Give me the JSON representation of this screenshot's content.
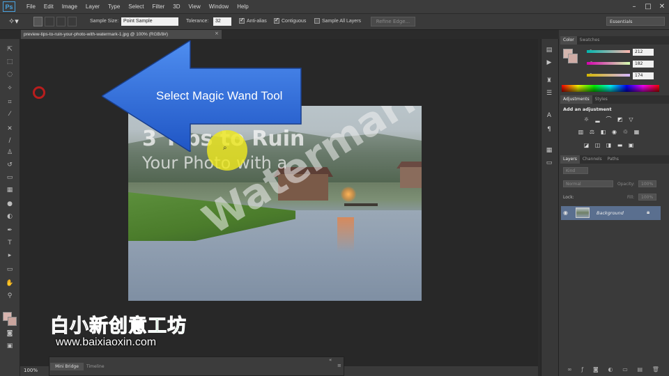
{
  "app": {
    "logo": "Ps"
  },
  "menu": [
    "File",
    "Edit",
    "Image",
    "Layer",
    "Type",
    "Select",
    "Filter",
    "3D",
    "View",
    "Window",
    "Help"
  ],
  "window_controls": [
    "–",
    "□",
    "✕"
  ],
  "options_bar": {
    "sample_size_label": "Sample Size:",
    "sample_size_value": "Point Sample",
    "tolerance_label": "Tolerance:",
    "tolerance_value": "32",
    "anti_alias_label": "Anti-alias",
    "contiguous_label": "Contiguous",
    "sample_all_layers_label": "Sample All Layers",
    "refine_edge_label": "Refine Edge...",
    "workspace": "Essentials"
  },
  "document": {
    "tab_title": "preview-tips-to-ruin-your-photo-with-watermark-1.jpg @ 100% (RGB/8#)",
    "close": "×",
    "zoom": "100%"
  },
  "photo_text": {
    "line1": "3 Tips to Ruin",
    "line2": "Your Photo with a",
    "watermark": "Watermark"
  },
  "callout": {
    "text": "Select Magic Wand Tool",
    "color": "#2f6fd9"
  },
  "color_panel": {
    "tabs": [
      "Color",
      "Swatches"
    ],
    "r_label": "R",
    "r_value": "212",
    "g_label": "G",
    "g_value": "182",
    "b_label": "B",
    "b_value": "174"
  },
  "adjustments_panel": {
    "tabs": [
      "Adjustments",
      "Styles"
    ],
    "heading": "Add an adjustment"
  },
  "layers_panel": {
    "tabs": [
      "Layers",
      "Channels",
      "Paths"
    ],
    "kind": "Kind",
    "blend_mode": "Normal",
    "opacity_label": "Opacity:",
    "opacity_value": "100%",
    "lock_label": "Lock:",
    "fill_label": "Fill:",
    "fill_value": "100%",
    "layer_name": "Background"
  },
  "mini_bridge": {
    "tabs": [
      "Mini Bridge",
      "Timeline"
    ]
  },
  "brand": {
    "cn_part1": "白小新",
    "cn_part2": "创意工坊",
    "url": "www.baixiaoxin.com"
  },
  "colors": {
    "accent": "#2f6fd9",
    "highlight": "#eee81e",
    "brand_green": "#19b24a"
  }
}
